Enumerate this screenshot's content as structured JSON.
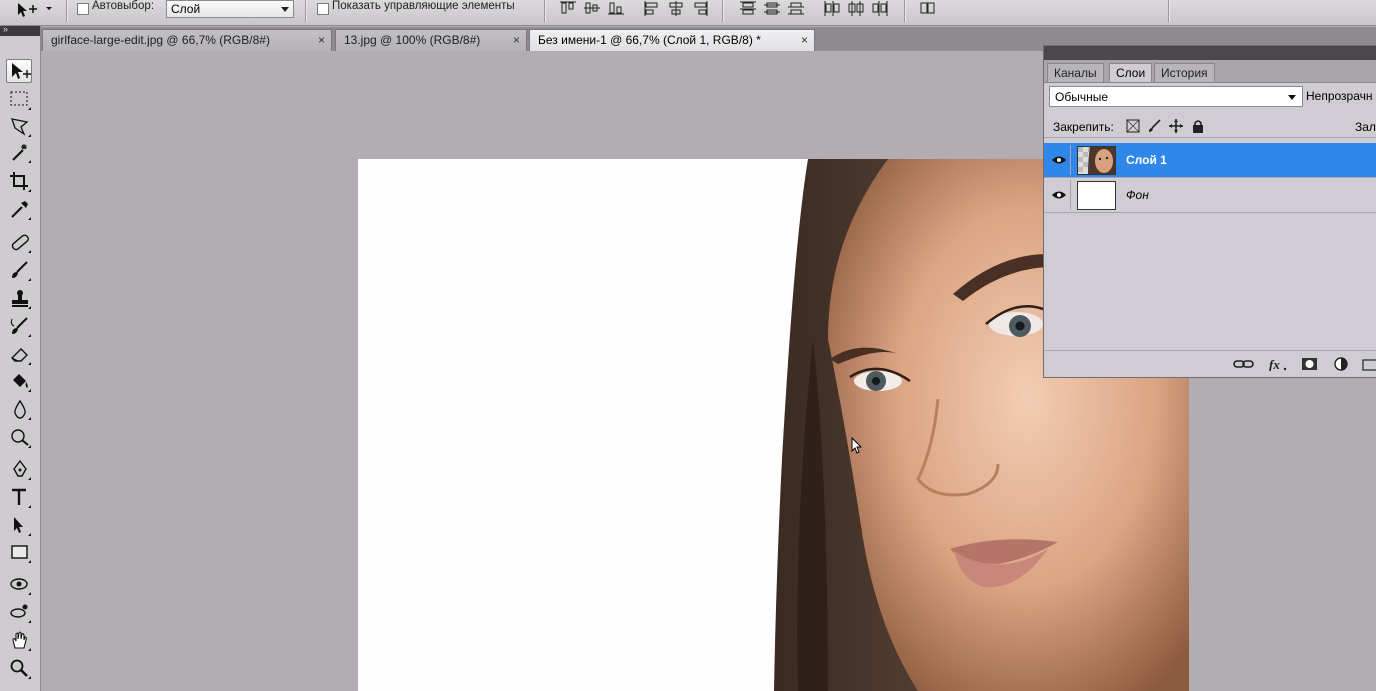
{
  "colors": {
    "workspace": "#b2adb3",
    "selection": "#2f87e9",
    "panel": "#d0ccd3"
  },
  "options_bar": {
    "tool_icon": "move-tool-icon",
    "auto_select_label": "Автовыбор:",
    "auto_select_checked": false,
    "auto_select_target": "Слой",
    "show_controls_label": "Показать управляющие элементы",
    "show_controls_checked": false,
    "align_icons": [
      "align-top-icon",
      "align-vcenter-icon",
      "align-bottom-icon",
      "align-left-icon",
      "align-hcenter-icon",
      "align-right-icon",
      "distribute-top-icon",
      "distribute-vcenter-icon",
      "distribute-bottom-icon",
      "distribute-left-icon",
      "distribute-hcenter-icon",
      "distribute-right-icon",
      "auto-align-icon"
    ]
  },
  "toolbox": {
    "collapse_glyph": "»",
    "tools": [
      "move",
      "marquee",
      "lasso",
      "magic-wand",
      "crop",
      "eyedropper",
      "healing-brush",
      "brush",
      "clone-stamp",
      "history-brush",
      "eraser",
      "paint-bucket",
      "blur",
      "dodge",
      "pen",
      "type",
      "path-selection",
      "rectangle",
      "3d-rotate",
      "3d-orbit",
      "hand",
      "zoom"
    ]
  },
  "tabs": [
    {
      "label": "girlface-large-edit.jpg @ 66,7% (RGB/8#)",
      "close": "×",
      "active": false
    },
    {
      "label": "13.jpg @ 100% (RGB/8#)",
      "close": "×",
      "active": false
    },
    {
      "label": "Без имени-1 @ 66,7% (Слой 1, RGB/8) *",
      "close": "×",
      "active": true
    }
  ],
  "layers_panel": {
    "tabs": [
      {
        "label": "Каналы",
        "active": false
      },
      {
        "label": "Слои",
        "active": true
      },
      {
        "label": "История",
        "active": false
      }
    ],
    "blend_mode": "Обычные",
    "opacity_label": "Непрозрачн",
    "lock_label": "Закрепить:",
    "fill_label": "Зали",
    "layers": [
      {
        "name": "Слой 1",
        "selected": true,
        "visible": true
      },
      {
        "name": "Фон",
        "selected": false,
        "visible": true
      }
    ],
    "bottom_icons": [
      "link-layers-icon",
      "fx-icon",
      "add-mask-icon",
      "adjustment-layer-icon",
      "new-group-icon"
    ]
  }
}
